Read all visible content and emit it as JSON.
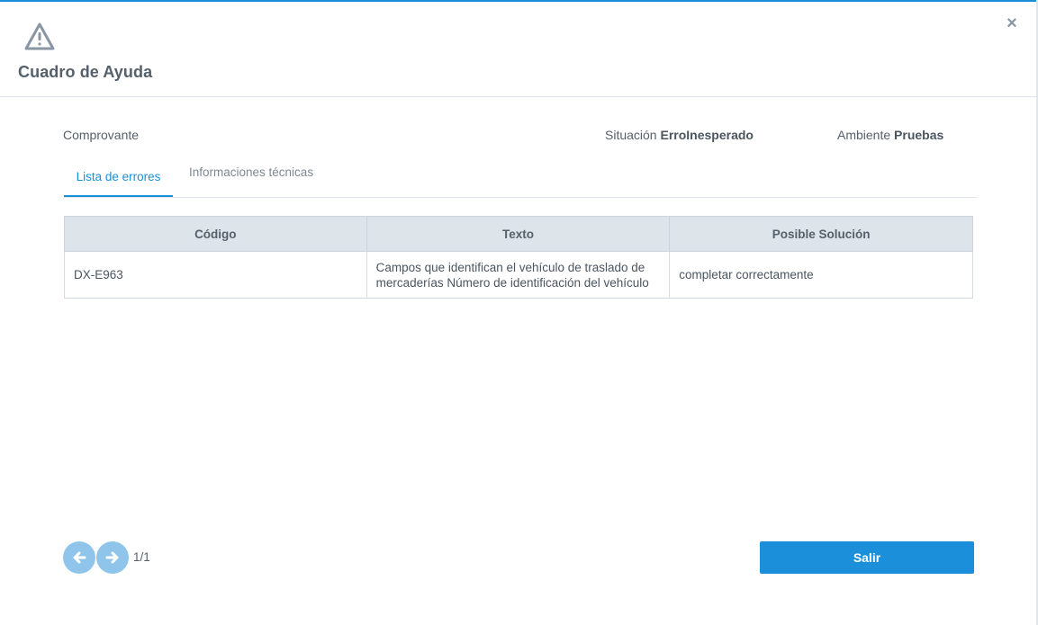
{
  "dialog": {
    "title": "Cuadro de Ayuda",
    "close_icon": "×",
    "warning_icon": "warning-triangle-icon"
  },
  "info": {
    "comprovante_label": "Comprovante",
    "situacion_label": "Situación",
    "situacion_value": "ErroInesperado",
    "ambiente_label": "Ambiente",
    "ambiente_value": "Pruebas"
  },
  "tabs": [
    {
      "label": "Lista de errores",
      "active": true
    },
    {
      "label": "Informaciones técnicas",
      "active": false
    }
  ],
  "table": {
    "headers": [
      "Código",
      "Texto",
      "Posible Solución"
    ],
    "rows": [
      [
        "DX-E963",
        "Campos que identifican el vehículo de traslado de mercaderías Número de identificación del vehículo",
        "completar correctamente"
      ]
    ]
  },
  "pager": {
    "text": "1/1"
  },
  "footer": {
    "exit_label": "Salir"
  },
  "colors": {
    "accent": "#1b8fd9",
    "nav_button": "#8fc5ea",
    "header_bg": "#dde4ea"
  }
}
